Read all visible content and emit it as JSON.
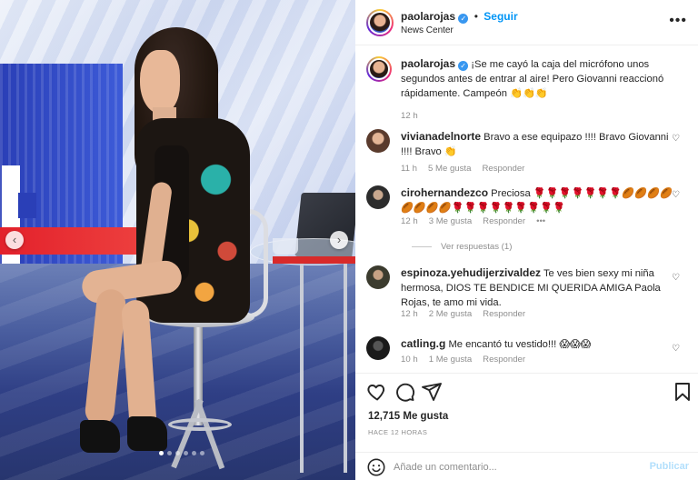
{
  "post": {
    "username": "paolarojas",
    "location": "News Center",
    "follow_label": "Seguir",
    "more_label": "•••",
    "caption": "¡Se me cayó la caja del micrófono unos segundos antes de entrar al aire! Pero Giovanni reaccionó rápidamente. Campeón 👏👏👏",
    "caption_time": "12 h"
  },
  "comments": [
    {
      "user": "vivianadelnorte",
      "text": "Bravo a ese equipazo !!!! Bravo Giovanni !!!! Bravo 👏",
      "time": "11 h",
      "likes": "5 Me gusta",
      "reply": "Responder"
    },
    {
      "user": "ciroherna­ndezco",
      "text": "Preciosa 🌹🌹🌹🌹🌹🌹🌹🏉🏉🏉🏉🏉🏉🏉🏉🌹🌹🌹🌹🌹🌹🌹🌹🌹",
      "time": "12 h",
      "likes": "3 Me gusta",
      "reply": "Responder",
      "more": "•••",
      "view_replies": "Ver respuestas (1)"
    },
    {
      "user": "espinoza.yehudijerzivaldez",
      "text": "Te ves bien sexy mi niña hermosa, DIOS TE BENDICE MI QUERIDA AMIGA Paola Rojas, te amo mi vida.",
      "time": "12 h",
      "likes": "2 Me gusta",
      "reply": "Responder"
    },
    {
      "user": "catling.g",
      "text": "Me encantó tu vestido!!! 😱😱😱",
      "time": "10 h",
      "likes": "1 Me gusta",
      "reply": "Responder"
    }
  ],
  "footer": {
    "likes": "12,715 Me gusta",
    "ago": "HACE 12 HORAS",
    "comment_placeholder": "Añade un comentario...",
    "publish_label": "Publicar"
  },
  "icons": {
    "like": "heart-icon",
    "comment": "comment-icon",
    "share": "send-icon",
    "save": "bookmark-icon",
    "emoji": "emoji-icon",
    "prev": "chevron-left-icon",
    "next": "chevron-right-icon"
  },
  "colors": {
    "accent": "#0095f6",
    "verified": "#3897f0",
    "muted": "#8e8e8e"
  },
  "carousel": {
    "slide_count": 6,
    "active_index": 0
  }
}
